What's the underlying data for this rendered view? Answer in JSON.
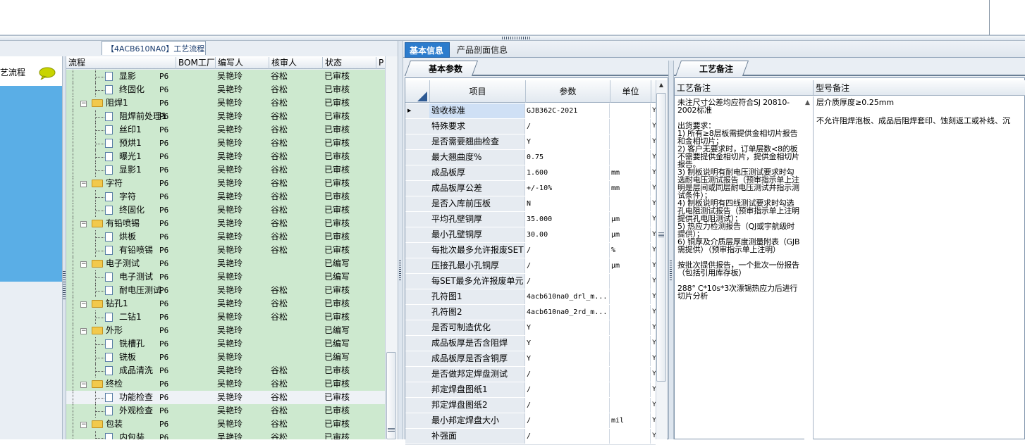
{
  "left_panel": {
    "tab_title": "【4ACB610NA0】工艺流程",
    "side_title": "艺流程",
    "columns": [
      "流程",
      "BOM工厂",
      "编写人",
      "核审人",
      "状态",
      "P"
    ],
    "rows": [
      {
        "name": "显影",
        "level": 2,
        "type": "doc",
        "bom": "P6",
        "author": "吴艳玲",
        "reviewer": "谷松",
        "status": "已审核"
      },
      {
        "name": "终固化",
        "level": 2,
        "type": "doc",
        "bom": "P6",
        "author": "吴艳玲",
        "reviewer": "谷松",
        "status": "已审核"
      },
      {
        "name": "阻焊1",
        "level": 1,
        "type": "folder",
        "bom": "P6",
        "author": "吴艳玲",
        "reviewer": "谷松",
        "status": "已审核"
      },
      {
        "name": "阻焊前处理1",
        "level": 2,
        "type": "doc",
        "bom": "P6",
        "author": "吴艳玲",
        "reviewer": "谷松",
        "status": "已审核"
      },
      {
        "name": "丝印1",
        "level": 2,
        "type": "doc",
        "bom": "P6",
        "author": "吴艳玲",
        "reviewer": "谷松",
        "status": "已审核"
      },
      {
        "name": "预烘1",
        "level": 2,
        "type": "doc",
        "bom": "P6",
        "author": "吴艳玲",
        "reviewer": "谷松",
        "status": "已审核"
      },
      {
        "name": "曝光1",
        "level": 2,
        "type": "doc",
        "bom": "P6",
        "author": "吴艳玲",
        "reviewer": "谷松",
        "status": "已审核"
      },
      {
        "name": "显影1",
        "level": 2,
        "type": "doc",
        "bom": "P6",
        "author": "吴艳玲",
        "reviewer": "谷松",
        "status": "已审核"
      },
      {
        "name": "字符",
        "level": 1,
        "type": "folder",
        "bom": "P6",
        "author": "吴艳玲",
        "reviewer": "谷松",
        "status": "已审核"
      },
      {
        "name": "字符",
        "level": 2,
        "type": "doc",
        "bom": "P6",
        "author": "吴艳玲",
        "reviewer": "谷松",
        "status": "已审核"
      },
      {
        "name": "终固化",
        "level": 2,
        "type": "doc",
        "bom": "P6",
        "author": "吴艳玲",
        "reviewer": "谷松",
        "status": "已审核"
      },
      {
        "name": "有铅喷锡",
        "level": 1,
        "type": "folder",
        "bom": "P6",
        "author": "吴艳玲",
        "reviewer": "谷松",
        "status": "已审核"
      },
      {
        "name": "烘板",
        "level": 2,
        "type": "doc",
        "bom": "P6",
        "author": "吴艳玲",
        "reviewer": "谷松",
        "status": "已审核"
      },
      {
        "name": "有铅喷锡",
        "level": 2,
        "type": "doc",
        "bom": "P6",
        "author": "吴艳玲",
        "reviewer": "谷松",
        "status": "已审核"
      },
      {
        "name": "电子测试",
        "level": 1,
        "type": "folder",
        "bom": "P6",
        "author": "吴艳玲",
        "reviewer": "",
        "status": "已编写"
      },
      {
        "name": "电子测试",
        "level": 2,
        "type": "doc",
        "bom": "P6",
        "author": "吴艳玲",
        "reviewer": "",
        "status": "已编写"
      },
      {
        "name": "耐电压测试",
        "level": 2,
        "type": "doc",
        "bom": "P6",
        "author": "吴艳玲",
        "reviewer": "谷松",
        "status": "已审核"
      },
      {
        "name": "钻孔1",
        "level": 1,
        "type": "folder",
        "bom": "P6",
        "author": "吴艳玲",
        "reviewer": "谷松",
        "status": "已审核"
      },
      {
        "name": "二钻1",
        "level": 2,
        "type": "doc",
        "bom": "P6",
        "author": "吴艳玲",
        "reviewer": "谷松",
        "status": "已审核"
      },
      {
        "name": "外形",
        "level": 1,
        "type": "folder",
        "bom": "P6",
        "author": "吴艳玲",
        "reviewer": "",
        "status": "已编写"
      },
      {
        "name": "铣槽孔",
        "level": 2,
        "type": "doc",
        "bom": "P6",
        "author": "吴艳玲",
        "reviewer": "",
        "status": "已编写"
      },
      {
        "name": "铣板",
        "level": 2,
        "type": "doc",
        "bom": "P6",
        "author": "吴艳玲",
        "reviewer": "",
        "status": "已编写"
      },
      {
        "name": "成品清洗",
        "level": 2,
        "type": "doc",
        "bom": "P6",
        "author": "吴艳玲",
        "reviewer": "谷松",
        "status": "已审核"
      },
      {
        "name": "终检",
        "level": 1,
        "type": "folder",
        "bom": "P6",
        "author": "吴艳玲",
        "reviewer": "谷松",
        "status": "已审核"
      },
      {
        "name": "功能检查",
        "level": 2,
        "type": "doc",
        "bom": "P6",
        "author": "吴艳玲",
        "reviewer": "谷松",
        "status": "已审核",
        "selected": true
      },
      {
        "name": "外观检查",
        "level": 2,
        "type": "doc",
        "bom": "P6",
        "author": "吴艳玲",
        "reviewer": "谷松",
        "status": "已审核"
      },
      {
        "name": "包装",
        "level": 1,
        "type": "folder",
        "bom": "P6",
        "author": "吴艳玲",
        "reviewer": "谷松",
        "status": "已审核"
      },
      {
        "name": "内包装",
        "level": 2,
        "type": "doc",
        "bom": "P6",
        "author": "吴艳玲",
        "reviewer": "谷松",
        "status": "已审核"
      }
    ]
  },
  "right_tabs": {
    "basic_info": "基本信息",
    "profile_info": "产品剖面信息"
  },
  "params": {
    "tab_label": "基本参数",
    "col_item": "项目",
    "col_param": "参数",
    "col_unit": "单位",
    "rows": [
      {
        "item": "验收标准",
        "value": "GJB362C-2021",
        "unit": "",
        "flag": "Y",
        "current": true
      },
      {
        "item": "特殊要求",
        "value": "/",
        "unit": "",
        "flag": "Y"
      },
      {
        "item": "是否需要翘曲检查",
        "value": "Y",
        "unit": "",
        "flag": "Y"
      },
      {
        "item": "最大翘曲度%",
        "value": "0.75",
        "unit": "",
        "flag": "Y"
      },
      {
        "item": "成品板厚",
        "value": "1.600",
        "unit": "mm",
        "flag": "Y"
      },
      {
        "item": "成品板厚公差",
        "value": "+/-10%",
        "unit": "mm",
        "flag": "Y"
      },
      {
        "item": "是否入库前压板",
        "value": "N",
        "unit": "",
        "flag": "Y"
      },
      {
        "item": "平均孔壁铜厚",
        "value": "35.000",
        "unit": "μm",
        "flag": "Y"
      },
      {
        "item": "最小孔壁铜厚",
        "value": "30.00",
        "unit": "μm",
        "flag": "Y"
      },
      {
        "item": "每批次最多允许报废SET",
        "value": "/",
        "unit": "%",
        "flag": "Y"
      },
      {
        "item": "压接孔最小孔铜厚",
        "value": "/",
        "unit": "μm",
        "flag": "Y"
      },
      {
        "item": "每SET最多允许报废单元",
        "value": "/",
        "unit": "",
        "flag": "Y"
      },
      {
        "item": "孔符图1",
        "value": "4acb610na0_drl_m...",
        "unit": "",
        "flag": "Y"
      },
      {
        "item": "孔符图2",
        "value": "4acb610na0_2rd_m...",
        "unit": "",
        "flag": "Y"
      },
      {
        "item": "是否可制造优化",
        "value": "Y",
        "unit": "",
        "flag": "Y"
      },
      {
        "item": "成品板厚是否含阻焊",
        "value": "Y",
        "unit": "",
        "flag": "Y"
      },
      {
        "item": "成品板厚是否含铜厚",
        "value": "Y",
        "unit": "",
        "flag": "Y"
      },
      {
        "item": "是否做邦定焊盘测试",
        "value": "/",
        "unit": "",
        "flag": "Y"
      },
      {
        "item": "邦定焊盘图纸1",
        "value": "/",
        "unit": "",
        "flag": "Y"
      },
      {
        "item": "邦定焊盘图纸2",
        "value": "/",
        "unit": "",
        "flag": "Y"
      },
      {
        "item": "最小邦定焊盘大小",
        "value": "/",
        "unit": "mil",
        "flag": "Y"
      },
      {
        "item": "补强面",
        "value": "/",
        "unit": "",
        "flag": "Y"
      }
    ]
  },
  "notes": {
    "tab_label": "工艺备注",
    "col1_header": "工艺备注",
    "col2_header": "型号备注",
    "col1_text": "未注尺寸公差均应符合SJ 20810-2002标准\n\n出货要求：\n1) 所有≥8层板需提供金相切片报告和金相切片；\n2) 客户无要求时，订单层数<8的板不需要提供金相切片，提供金相切片报告。\n3) 制板说明有耐电压测试要求时勾选耐电压测试报告（预审指示单上注明是层间或同层耐电压测试并指示测试条件）；\n4) 制板说明有四线测试要求时勾选孔电阻测试报告（预审指示单上注明提供孔电阻测试）；\n5) 热应力检测报告（QJ或宇航级时提供）；\n6) 铜厚及介质层厚度测量附表（GJB需提供）（预审指示单上注明）\n\n按批次提供报告，一个批次一份报告（包括引用库存板）\n\n288° C*10s*3次漂锡热应力后进行切片分析",
    "col2_text": "层介质厚度≥0.25mm\n\n不允许阻焊泡板、成品后阻焊套印、蚀刻返工或补线、沉"
  }
}
